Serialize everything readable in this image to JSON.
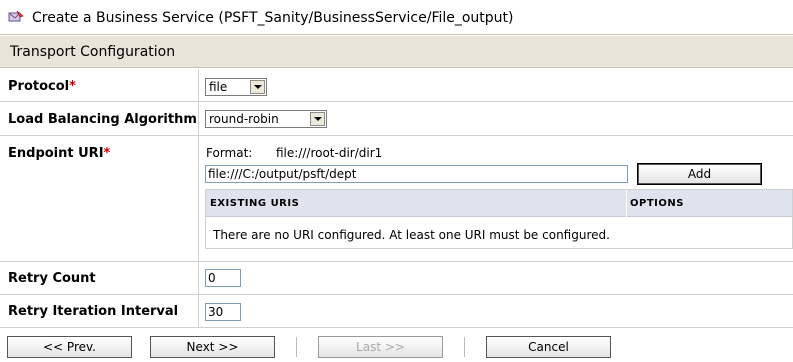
{
  "header": {
    "title": "Create a Business Service (PSFT_Sanity/BusinessService/File_output)",
    "icon": "business-service-icon"
  },
  "section": {
    "title": "Transport Configuration"
  },
  "form": {
    "protocol": {
      "label": "Protocol",
      "required": "*",
      "value": "file"
    },
    "load_balancing": {
      "label": "Load Balancing Algorithm",
      "value": "round-robin"
    },
    "endpoint": {
      "label": "Endpoint URI",
      "required": "*",
      "format_label": "Format:",
      "format_value": "file:///root-dir/dir1",
      "value": "file:///C:/output/psft/dept",
      "add_label": "Add",
      "table": {
        "col_uris": "EXISTING URIS",
        "col_options": "OPTIONS",
        "empty_message": "There are no URI configured. At least one URI must be configured."
      }
    },
    "retry_count": {
      "label": "Retry Count",
      "value": "0"
    },
    "retry_interval": {
      "label": "Retry Iteration Interval",
      "value": "30"
    }
  },
  "footer": {
    "prev_label": "<< Prev.",
    "next_label": "Next >>",
    "last_label": "Last >>",
    "cancel_label": "Cancel"
  }
}
